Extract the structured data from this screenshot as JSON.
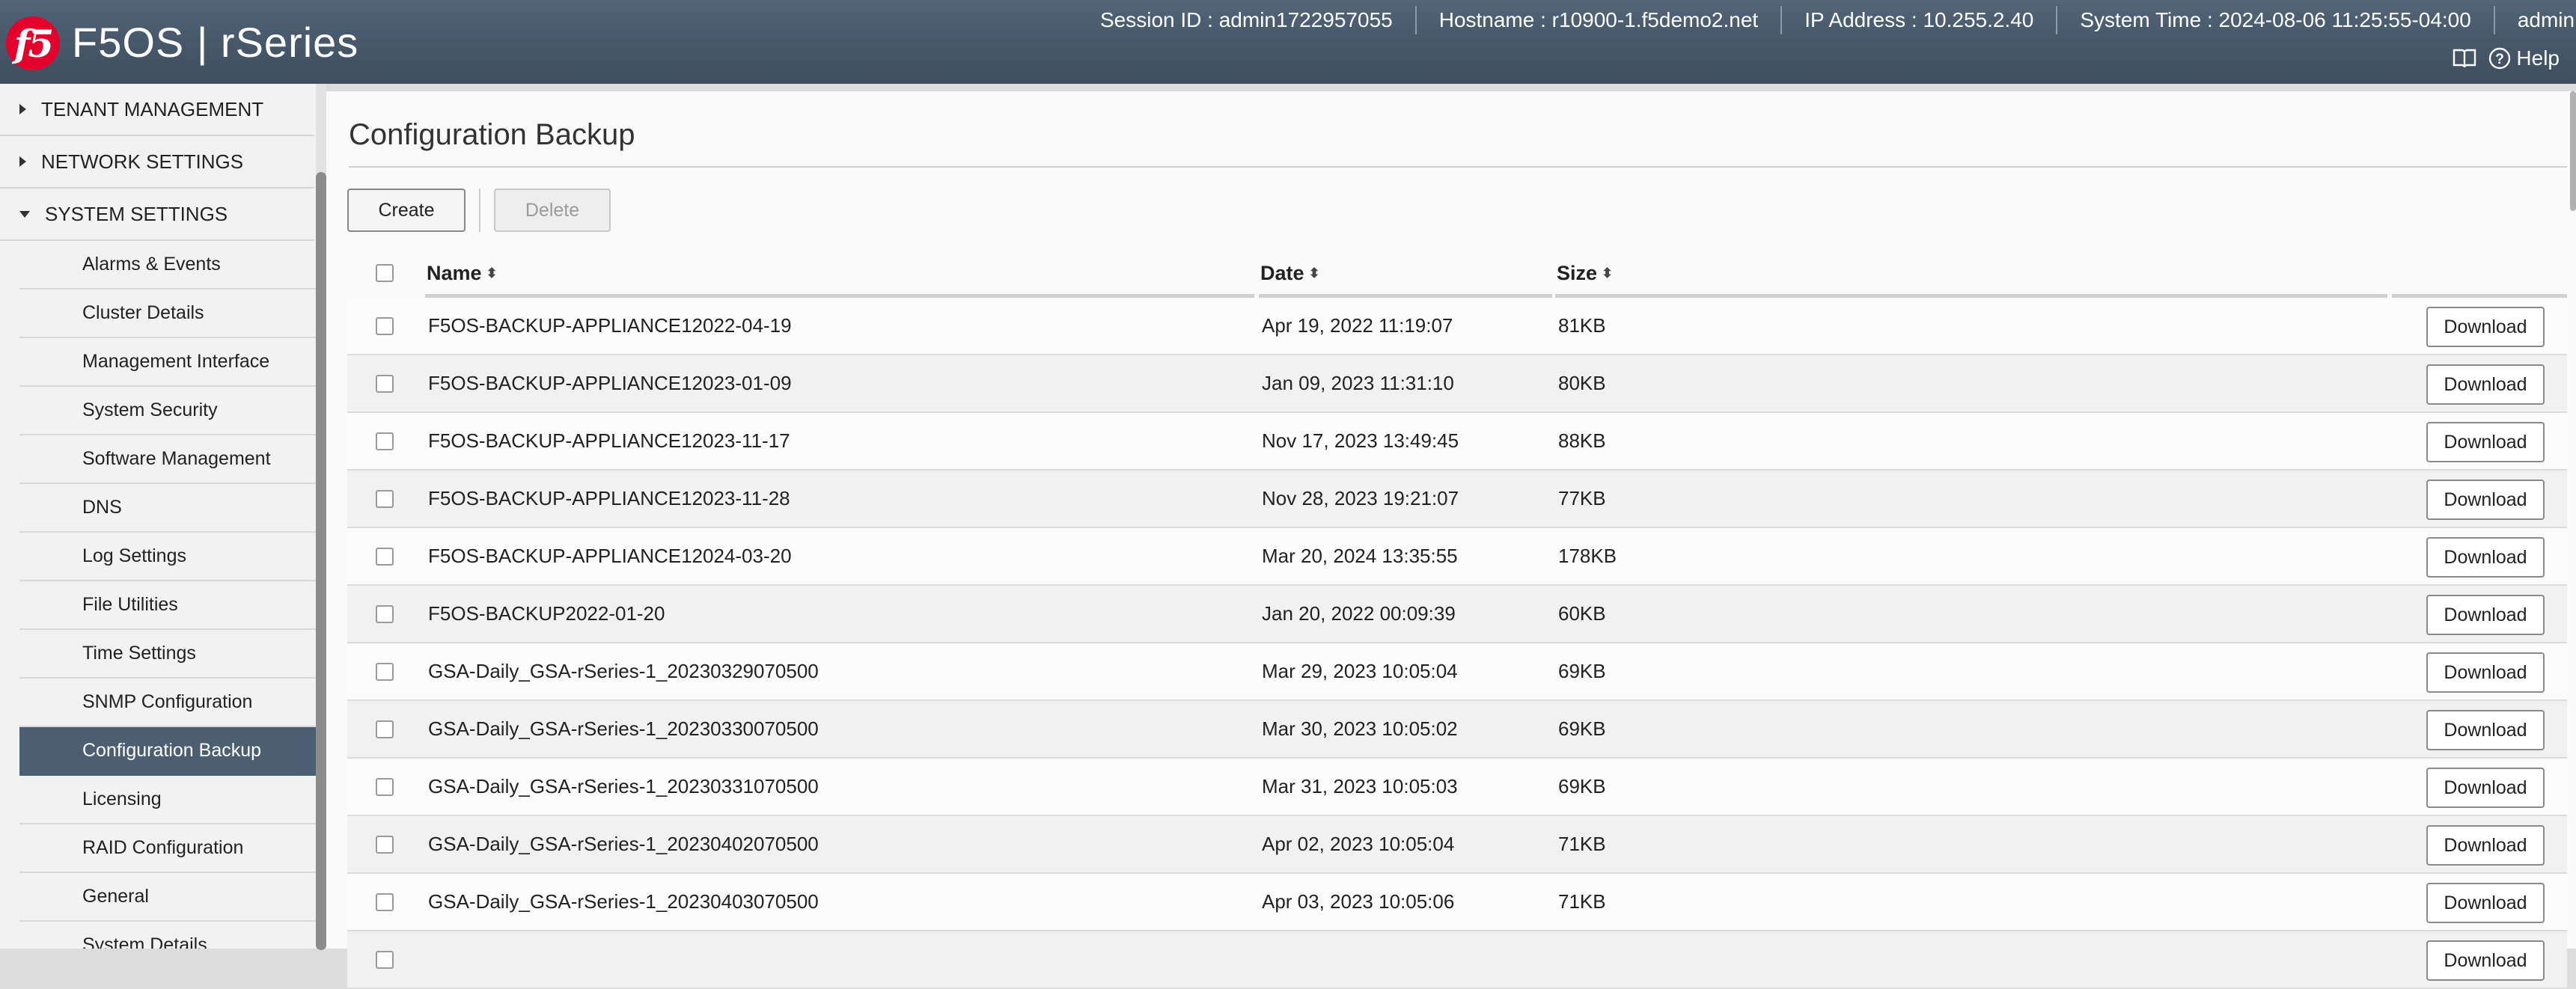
{
  "header": {
    "logo_text": "f5",
    "app_title": "F5OS | rSeries",
    "session_id": "Session ID : admin1722957055",
    "hostname": "Hostname : r10900-1.f5demo2.net",
    "ip_address": "IP Address : 10.255.2.40",
    "system_time": "System Time : 2024-08-06 11:25:55-04:00",
    "user": "admin",
    "help_label": "Help"
  },
  "sidebar": {
    "sections": [
      {
        "label": "TENANT MANAGEMENT",
        "expanded": false
      },
      {
        "label": "NETWORK SETTINGS",
        "expanded": false
      },
      {
        "label": "SYSTEM SETTINGS",
        "expanded": true
      }
    ],
    "items": [
      {
        "label": "Alarms & Events"
      },
      {
        "label": "Cluster Details"
      },
      {
        "label": "Management Interface"
      },
      {
        "label": "System Security"
      },
      {
        "label": "Software Management"
      },
      {
        "label": "DNS"
      },
      {
        "label": "Log Settings"
      },
      {
        "label": "File Utilities"
      },
      {
        "label": "Time Settings"
      },
      {
        "label": "SNMP Configuration"
      },
      {
        "label": "Configuration Backup",
        "active": true
      },
      {
        "label": "Licensing"
      },
      {
        "label": "RAID Configuration"
      },
      {
        "label": "General"
      },
      {
        "label": "System Details"
      }
    ]
  },
  "main": {
    "title": "Configuration Backup",
    "create_label": "Create",
    "delete_label": "Delete",
    "columns": {
      "name": "Name",
      "date": "Date",
      "size": "Size"
    },
    "download_label": "Download",
    "rows": [
      {
        "name": "F5OS-BACKUP-APPLIANCE12022-04-19",
        "date": "Apr 19, 2022 11:19:07",
        "size": "81KB"
      },
      {
        "name": "F5OS-BACKUP-APPLIANCE12023-01-09",
        "date": "Jan 09, 2023 11:31:10",
        "size": "80KB"
      },
      {
        "name": "F5OS-BACKUP-APPLIANCE12023-11-17",
        "date": "Nov 17, 2023 13:49:45",
        "size": "88KB"
      },
      {
        "name": "F5OS-BACKUP-APPLIANCE12023-11-28",
        "date": "Nov 28, 2023 19:21:07",
        "size": "77KB"
      },
      {
        "name": "F5OS-BACKUP-APPLIANCE12024-03-20",
        "date": "Mar 20, 2024 13:35:55",
        "size": "178KB"
      },
      {
        "name": "F5OS-BACKUP2022-01-20",
        "date": "Jan 20, 2022 00:09:39",
        "size": "60KB"
      },
      {
        "name": "GSA-Daily_GSA-rSeries-1_20230329070500",
        "date": "Mar 29, 2023 10:05:04",
        "size": "69KB"
      },
      {
        "name": "GSA-Daily_GSA-rSeries-1_20230330070500",
        "date": "Mar 30, 2023 10:05:02",
        "size": "69KB"
      },
      {
        "name": "GSA-Daily_GSA-rSeries-1_20230331070500",
        "date": "Mar 31, 2023 10:05:03",
        "size": "69KB"
      },
      {
        "name": "GSA-Daily_GSA-rSeries-1_20230402070500",
        "date": "Apr 02, 2023 10:05:04",
        "size": "71KB"
      },
      {
        "name": "GSA-Daily_GSA-rSeries-1_20230403070500",
        "date": "Apr 03, 2023 10:05:06",
        "size": "71KB"
      },
      {
        "name": "",
        "date": "",
        "size": ""
      }
    ]
  },
  "colors": {
    "header": "#46566a",
    "active_item": "#4c5e72",
    "logo": "#e4002b"
  }
}
